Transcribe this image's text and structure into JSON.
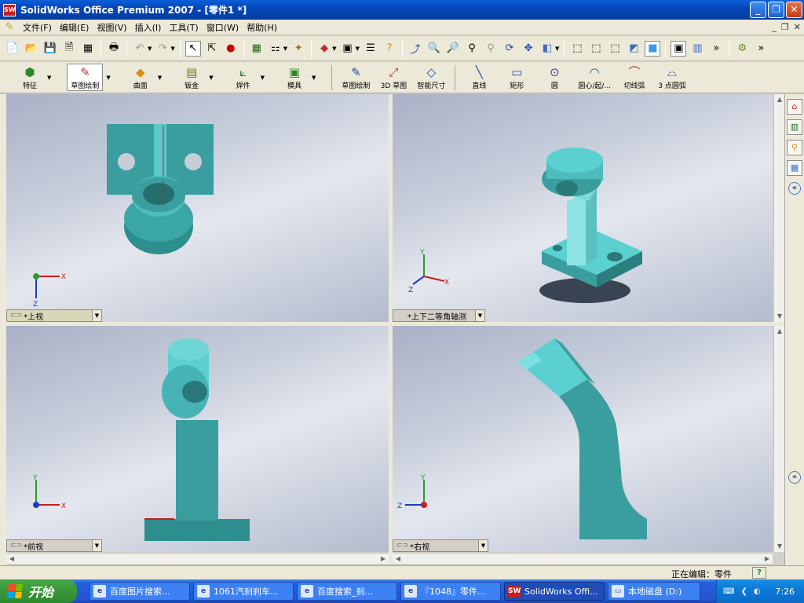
{
  "window": {
    "title": "SolidWorks Office Premium 2007 - [零件1 *]",
    "logo": "SW",
    "min": "_",
    "max": "❐",
    "close": "✕"
  },
  "menu": {
    "items": [
      "文件(F)",
      "编辑(E)",
      "视图(V)",
      "插入(I)",
      "工具(T)",
      "窗口(W)",
      "帮助(H)"
    ],
    "mdi": [
      "_",
      "❐",
      "✕"
    ]
  },
  "command_manager": {
    "groups": [
      {
        "label": "特征",
        "icon": "feature-icon"
      },
      {
        "label": "草图绘制",
        "icon": "sketch-icon"
      },
      {
        "label": "曲面",
        "icon": "surface-icon"
      },
      {
        "label": "钣金",
        "icon": "sheetmetal-icon"
      },
      {
        "label": "焊件",
        "icon": "weldment-icon"
      },
      {
        "label": "模具",
        "icon": "mold-icon"
      }
    ],
    "tools": [
      {
        "label": "草图绘制",
        "icon": "sketch-icon"
      },
      {
        "label": "3D 草图",
        "icon": "3d-sketch-icon"
      },
      {
        "label": "智能尺寸",
        "icon": "smart-dimension-icon"
      },
      {
        "label": "直线",
        "icon": "line-icon"
      },
      {
        "label": "矩形",
        "icon": "rectangle-icon"
      },
      {
        "label": "圆",
        "icon": "circle-icon"
      },
      {
        "label": "圆心/起/...",
        "icon": "centerpoint-arc-icon"
      },
      {
        "label": "切线弧",
        "icon": "tangent-arc-icon"
      },
      {
        "label": "3 点圆弧",
        "icon": "three-point-arc-icon"
      }
    ]
  },
  "viewports": {
    "top": {
      "label": "*上视",
      "axes": [
        "X",
        "Z"
      ]
    },
    "iso": {
      "label": "*上下二等角轴测",
      "axes": [
        "Y",
        "X",
        "Z"
      ]
    },
    "front": {
      "label": "*前视",
      "axes": [
        "Y",
        "X"
      ]
    },
    "right": {
      "label": "*右视",
      "axes": [
        "Y",
        "Z"
      ]
    }
  },
  "colors": {
    "part": "#3a9e9e",
    "part_light": "#6fd6d6",
    "part_dark": "#2a7878",
    "accent": "#c81e1e"
  },
  "status": {
    "text": "正在编辑：零件",
    "help": "?"
  },
  "taskbar": {
    "start": "开始",
    "tasks": [
      {
        "label": "百度图片搜索...",
        "icon": "e"
      },
      {
        "label": "1061汽刹刹车...",
        "icon": "e"
      },
      {
        "label": "百度搜索_刹...",
        "icon": "e"
      },
      {
        "label": "『1048』零件...",
        "icon": "e"
      },
      {
        "label": "SolidWorks Offi...",
        "icon": "SW"
      },
      {
        "label": "本地磁盘 (D:)",
        "icon": "▭"
      }
    ],
    "clock": "7:26"
  }
}
